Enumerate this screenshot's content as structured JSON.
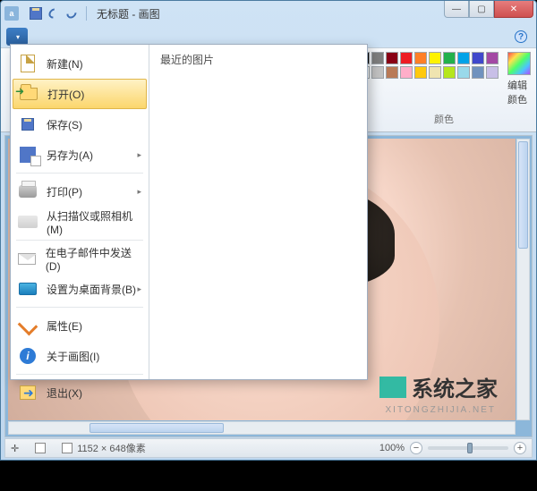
{
  "title": "无标题 - 画图",
  "winbtns": {
    "min": "—",
    "max": "▢",
    "close": "✕"
  },
  "file_menu_icon": "▥",
  "help": "?",
  "menu": {
    "recent_header": "最近的图片",
    "items": [
      {
        "label": "新建(N)"
      },
      {
        "label": "打开(O)"
      },
      {
        "label": "保存(S)"
      },
      {
        "label": "另存为(A)",
        "arrow": "▸"
      },
      {
        "label": "打印(P)",
        "arrow": "▸"
      },
      {
        "label": "从扫描仪或照相机(M)"
      },
      {
        "label": "在电子邮件中发送(D)"
      },
      {
        "label": "设置为桌面背景(B)",
        "arrow": "▸"
      },
      {
        "label": "属性(E)"
      },
      {
        "label": "关于画图(I)"
      },
      {
        "label": "退出(X)"
      }
    ]
  },
  "ribbon": {
    "colors_label": "颜色",
    "edit_colors": "编辑颜色",
    "palette": [
      "#000000",
      "#7f7f7f",
      "#880015",
      "#ed1c24",
      "#ff7f27",
      "#fff200",
      "#22b14c",
      "#00a2e8",
      "#3f48cc",
      "#a349a4",
      "#ffffff",
      "#c3c3c3",
      "#b97a57",
      "#ffaec9",
      "#ffc90e",
      "#efe4b0",
      "#b5e61d",
      "#99d9ea",
      "#7092be",
      "#c8bfe7"
    ]
  },
  "status": {
    "dims": "1152 × 648像素",
    "zoom": "100%",
    "zminus": "−",
    "zplus": "+"
  },
  "watermark": {
    "text": "系统之家",
    "sub": "XITONGZHIJIA.NET"
  }
}
